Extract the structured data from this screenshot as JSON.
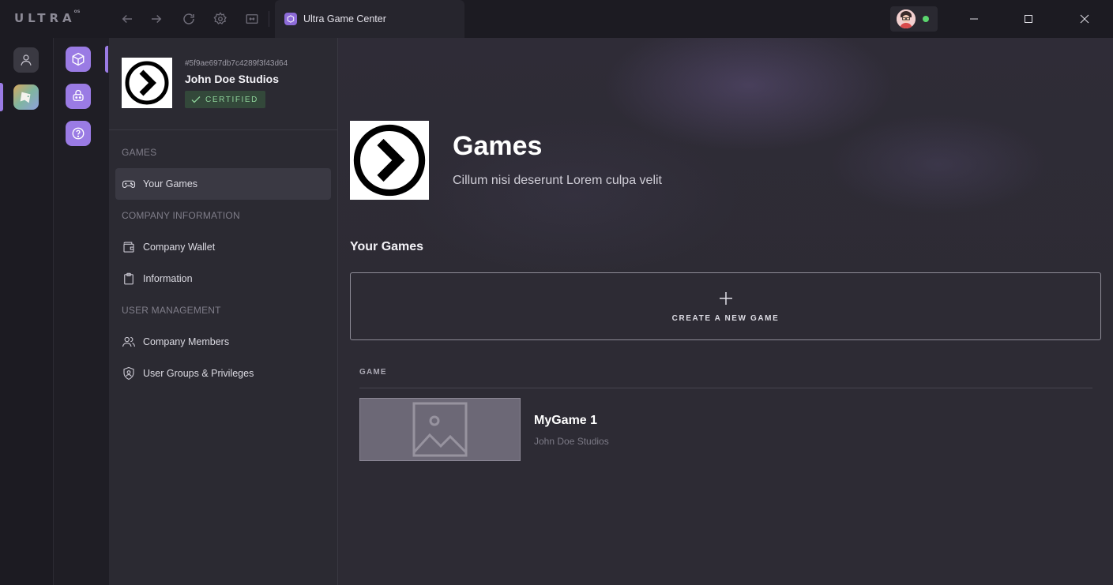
{
  "app": {
    "logo_text": "ULTRA",
    "logo_superscript": "os",
    "tab_title": "Ultra Game Center"
  },
  "company": {
    "id": "#5f9ae697db7c4289f3f43d64",
    "name": "John Doe Studios",
    "badge": "CERTIFIED"
  },
  "sidebar": {
    "sections": [
      {
        "title": "GAMES",
        "items": [
          {
            "label": "Your Games",
            "icon": "gamepad-icon",
            "active": true
          }
        ]
      },
      {
        "title": "COMPANY INFORMATION",
        "items": [
          {
            "label": "Company Wallet",
            "icon": "wallet-icon"
          },
          {
            "label": "Information",
            "icon": "clipboard-icon"
          }
        ]
      },
      {
        "title": "USER MANAGEMENT",
        "items": [
          {
            "label": "Company Members",
            "icon": "users-icon"
          },
          {
            "label": "User Groups & Privileges",
            "icon": "shield-user-icon"
          }
        ]
      }
    ]
  },
  "main": {
    "title": "Games",
    "subtitle": "Cillum nisi deserunt Lorem culpa velit",
    "section_heading": "Your Games",
    "create_label": "CREATE A NEW GAME",
    "column_header": "GAME",
    "games": [
      {
        "name": "MyGame 1",
        "studio": "John Doe Studios"
      }
    ]
  },
  "colors": {
    "accent": "#9a7be4",
    "status_online": "#5bd56e",
    "certified_text": "#8fd49b"
  }
}
